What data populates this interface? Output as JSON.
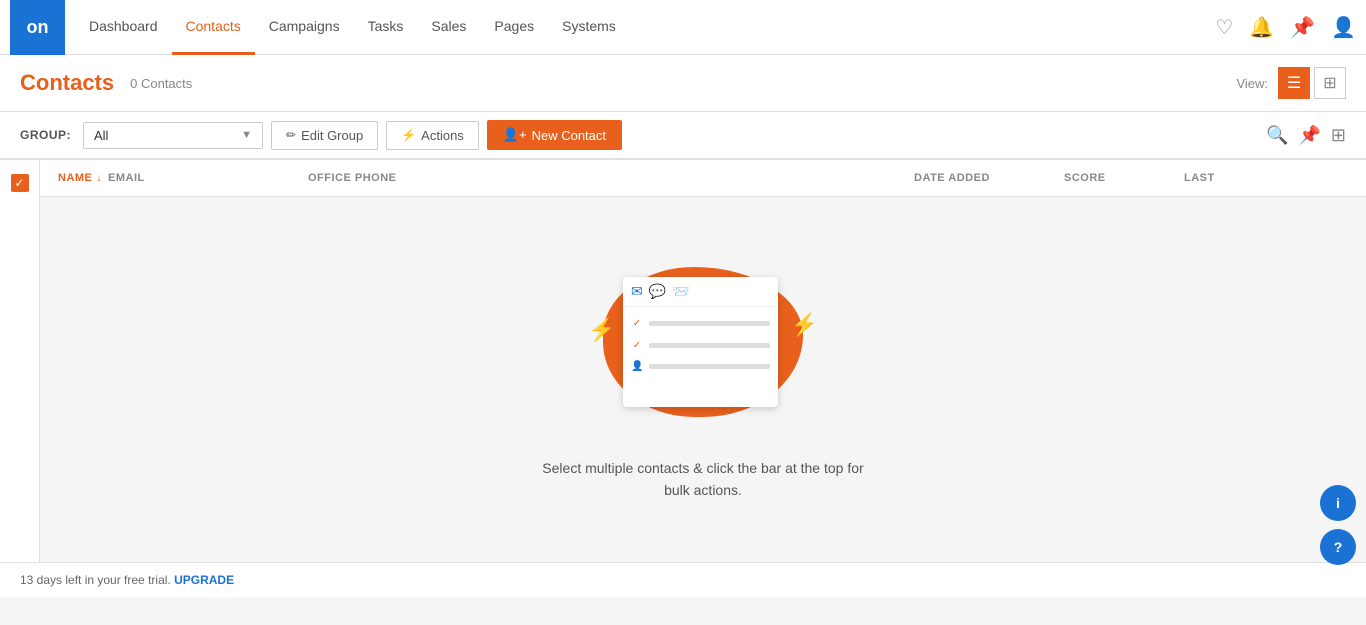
{
  "app": {
    "logo": "on",
    "nav_links": [
      {
        "id": "dashboard",
        "label": "Dashboard",
        "active": false
      },
      {
        "id": "contacts",
        "label": "Contacts",
        "active": true
      },
      {
        "id": "campaigns",
        "label": "Campaigns",
        "active": false
      },
      {
        "id": "tasks",
        "label": "Tasks",
        "active": false
      },
      {
        "id": "sales",
        "label": "Sales",
        "active": false
      },
      {
        "id": "pages",
        "label": "Pages",
        "active": false
      },
      {
        "id": "systems",
        "label": "Systems",
        "active": false
      }
    ]
  },
  "page": {
    "title": "Contacts",
    "contacts_count": "0 Contacts",
    "view_label": "View:",
    "view_list": "list",
    "view_grid": "grid"
  },
  "toolbar": {
    "group_label": "GROUP:",
    "group_value": "All",
    "edit_group_label": "Edit Group",
    "actions_label": "Actions",
    "new_contact_label": "New Contact"
  },
  "table": {
    "columns": [
      "NAME",
      "EMAIL",
      "OFFICE PHONE",
      "DATE ADDED",
      "SCORE",
      "LAST"
    ]
  },
  "empty_state": {
    "message_line1": "Select multiple contacts & click the bar at the top for",
    "message_line2": "bulk actions."
  },
  "bottom_bar": {
    "trial_text": "13 days left in your free trial.",
    "upgrade_label": "UPGRADE"
  }
}
